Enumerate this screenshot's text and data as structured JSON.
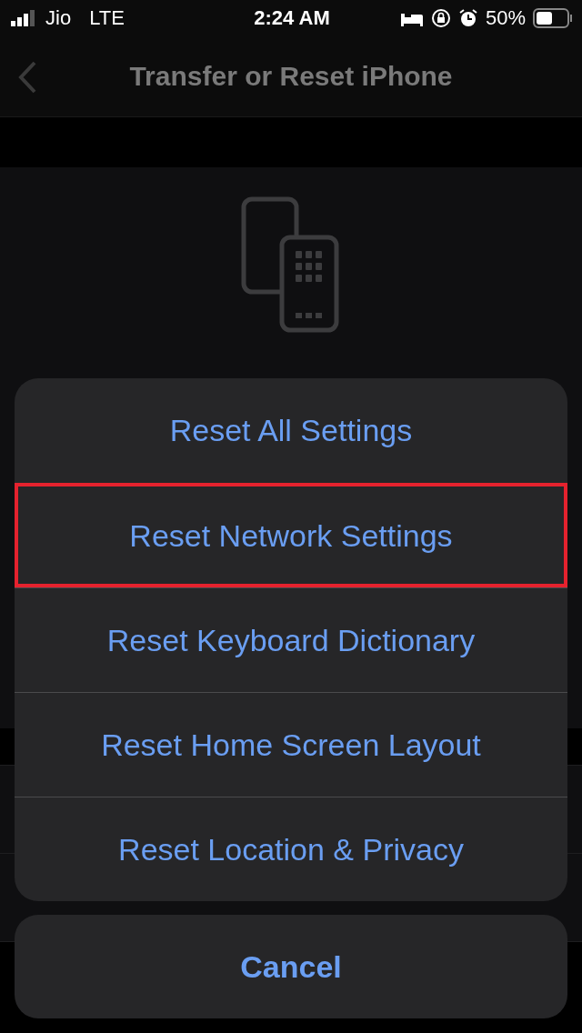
{
  "status_bar": {
    "carrier": "Jio",
    "network": "LTE",
    "time": "2:24 AM",
    "battery": "50%"
  },
  "nav_bar": {
    "title": "Transfer or Reset iPhone"
  },
  "action_sheet": {
    "items": [
      {
        "label": "Reset All Settings",
        "highlighted": false
      },
      {
        "label": "Reset Network Settings",
        "highlighted": true
      },
      {
        "label": "Reset Keyboard Dictionary",
        "highlighted": false
      },
      {
        "label": "Reset Home Screen Layout",
        "highlighted": false
      },
      {
        "label": "Reset Location & Privacy",
        "highlighted": false
      }
    ],
    "cancel": "Cancel"
  }
}
